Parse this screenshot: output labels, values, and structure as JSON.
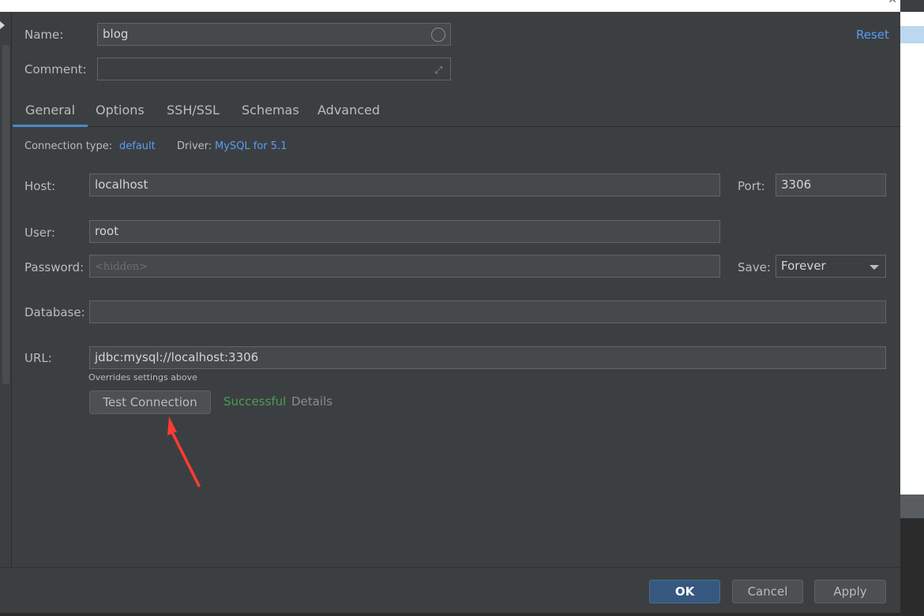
{
  "form": {
    "name_label": "Name:",
    "name_value": "blog",
    "comment_label": "Comment:",
    "comment_value": "",
    "reset_label": "Reset"
  },
  "tabs": [
    {
      "label": "General",
      "active": true
    },
    {
      "label": "Options",
      "active": false
    },
    {
      "label": "SSH/SSL",
      "active": false
    },
    {
      "label": "Schemas",
      "active": false
    },
    {
      "label": "Advanced",
      "active": false
    }
  ],
  "connection": {
    "type_label": "Connection type:",
    "type_value": "default",
    "driver_label": "Driver:",
    "driver_value": "MySQL for 5.1"
  },
  "general": {
    "host_label": "Host:",
    "host_value": "localhost",
    "port_label": "Port:",
    "port_value": "3306",
    "user_label": "User:",
    "user_value": "root",
    "password_label": "Password:",
    "password_placeholder": "<hidden>",
    "save_label": "Save:",
    "save_value": "Forever",
    "database_label": "Database:",
    "database_value": "",
    "url_label": "URL:",
    "url_value": "jdbc:mysql://localhost:3306",
    "url_hint": "Overrides settings above",
    "test_connection_label": "Test Connection",
    "status_text": "Successful",
    "details_label": "Details"
  },
  "footer": {
    "ok_label": "OK",
    "cancel_label": "Cancel",
    "apply_label": "Apply"
  },
  "colors": {
    "background": "#3c3f41",
    "accent": "#589df6",
    "success": "#499c54",
    "annotation_arrow": "#ff3b30"
  }
}
